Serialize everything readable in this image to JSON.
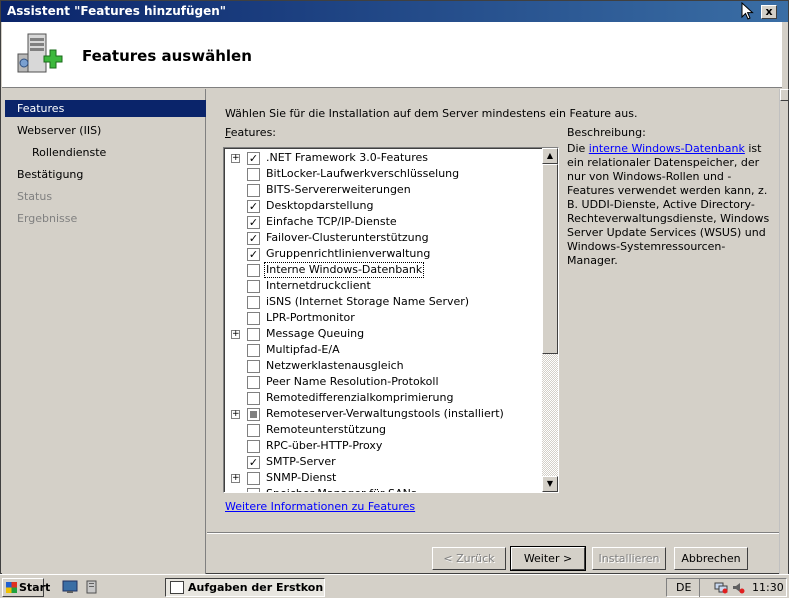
{
  "window": {
    "title": "Assistent \"Features hinzufügen\"",
    "close_label": "x",
    "heading": "Features auswählen"
  },
  "nav": {
    "items": [
      {
        "label": "Features",
        "state": "active"
      },
      {
        "label": "Webserver (IIS)",
        "state": "normal"
      },
      {
        "label": "Rollendienste",
        "state": "sub"
      },
      {
        "label": "Bestätigung",
        "state": "normal"
      },
      {
        "label": "Status",
        "state": "disabled"
      },
      {
        "label": "Ergebnisse",
        "state": "disabled"
      }
    ]
  },
  "main": {
    "instruction": "Wählen Sie für die Installation auf dem Server mindestens ein Feature aus.",
    "features_label_accel": "F",
    "features_label_rest": "eatures:",
    "description_label": "Beschreibung:",
    "description_prefix": "Die ",
    "description_link": "interne Windows-Datenbank",
    "description_text": " ist ein relationaler Datenspeicher, der nur von Windows-Rollen und -Features verwendet werden kann, z. B. UDDI-Dienste, Active Directory-Rechteverwaltungsdienste, Windows Server Update Services (WSUS) und Windows-Systemressourcen-Manager.",
    "more_info_link": "Weitere Informationen zu Features"
  },
  "features": [
    {
      "label": ".NET Framework 3.0-Features",
      "expandable": true,
      "checked": true
    },
    {
      "label": "BitLocker-Laufwerkverschlüsselung",
      "expandable": false,
      "checked": false
    },
    {
      "label": "BITS-Servererweiterungen",
      "expandable": false,
      "checked": false
    },
    {
      "label": "Desktopdarstellung",
      "expandable": false,
      "checked": true
    },
    {
      "label": "Einfache TCP/IP-Dienste",
      "expandable": false,
      "checked": true
    },
    {
      "label": "Failover-Clusterunterstützung",
      "expandable": false,
      "checked": true
    },
    {
      "label": "Gruppenrichtlinienverwaltung",
      "expandable": false,
      "checked": true
    },
    {
      "label": "Interne Windows-Datenbank",
      "expandable": false,
      "checked": false,
      "selected": true
    },
    {
      "label": "Internetdruckclient",
      "expandable": false,
      "checked": false
    },
    {
      "label": "iSNS (Internet Storage Name Server)",
      "expandable": false,
      "checked": false
    },
    {
      "label": "LPR-Portmonitor",
      "expandable": false,
      "checked": false
    },
    {
      "label": "Message Queuing",
      "expandable": true,
      "checked": false
    },
    {
      "label": "Multipfad-E/A",
      "expandable": false,
      "checked": false
    },
    {
      "label": "Netzwerklastenausgleich",
      "expandable": false,
      "checked": false
    },
    {
      "label": "Peer Name Resolution-Protokoll",
      "expandable": false,
      "checked": false
    },
    {
      "label": "Remotedifferenzialkomprimierung",
      "expandable": false,
      "checked": false
    },
    {
      "label": "Remoteserver-Verwaltungstools (installiert)",
      "expandable": true,
      "checked": "partial"
    },
    {
      "label": "Remoteunterstützung",
      "expandable": false,
      "checked": false
    },
    {
      "label": "RPC-über-HTTP-Proxy",
      "expandable": false,
      "checked": false
    },
    {
      "label": "SMTP-Server",
      "expandable": false,
      "checked": true
    },
    {
      "label": "SNMP-Dienst",
      "expandable": true,
      "checked": false
    },
    {
      "label": "Speicher-Manager für SANs",
      "expandable": false,
      "checked": false
    }
  ],
  "buttons": {
    "back": "< Zurück",
    "next": "Weiter >",
    "install": "Installieren",
    "cancel": "Abbrechen"
  },
  "taskbar": {
    "start": "Start",
    "task": "Aufgaben der Erstkon...",
    "lang": "DE",
    "clock": "11:30"
  }
}
